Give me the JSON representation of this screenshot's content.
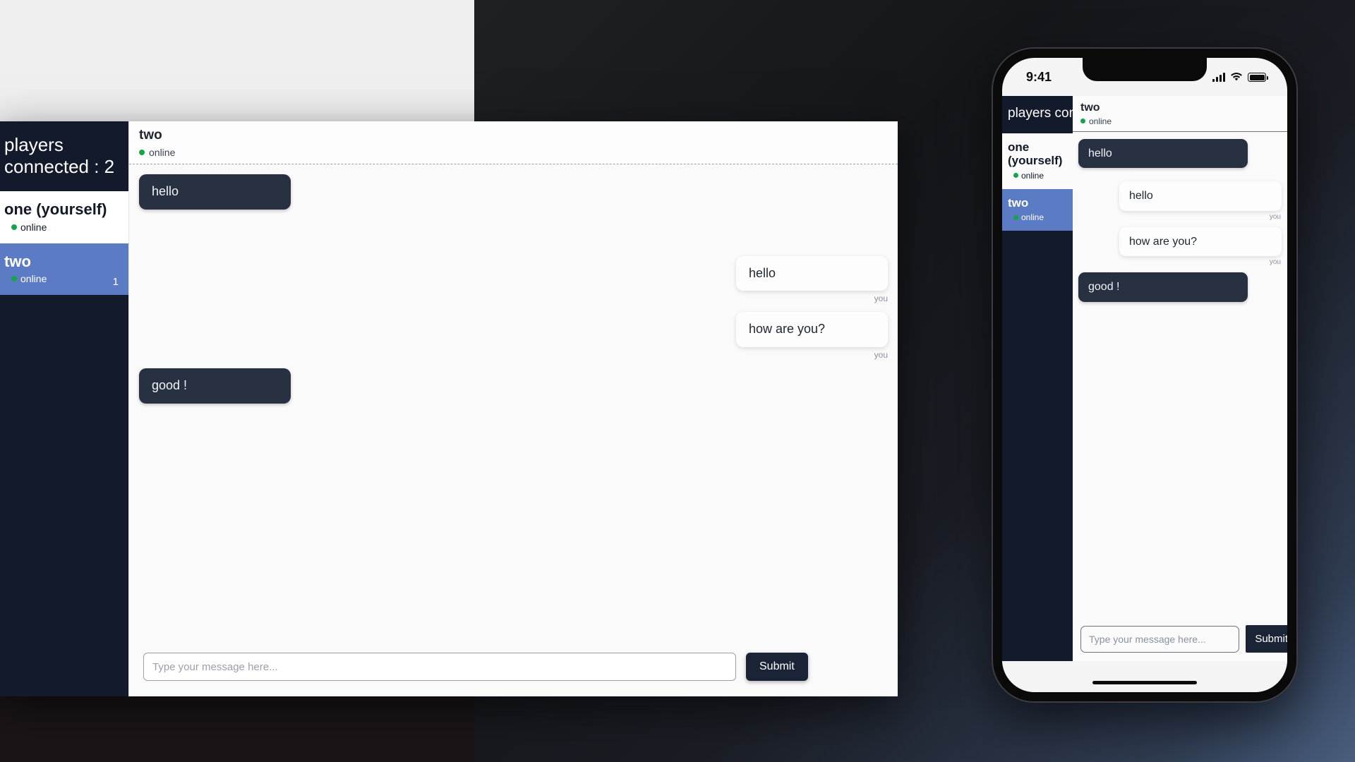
{
  "app": {
    "sidebar": {
      "players_connected_label": "players connected : 2",
      "players": [
        {
          "name": "one (yourself)",
          "status": "online",
          "selected": false,
          "badge": ""
        },
        {
          "name": "two",
          "status": "online",
          "selected": true,
          "badge": "1"
        }
      ]
    },
    "chat": {
      "header_name": "two",
      "header_status": "online",
      "messages": [
        {
          "text": "hello",
          "from": "them",
          "meta": ""
        },
        {
          "text": "hello",
          "from": "me",
          "meta": "you"
        },
        {
          "text": "how are you?",
          "from": "me",
          "meta": "you"
        },
        {
          "text": "good !",
          "from": "them",
          "meta": ""
        }
      ]
    },
    "composer": {
      "placeholder": "Type your message here...",
      "value": "",
      "submit_label": "Submit"
    }
  },
  "phone": {
    "status_bar": {
      "time": "9:41",
      "signal_icon": "cellular-bars-icon",
      "wifi_icon": "wifi-icon",
      "battery_icon": "battery-icon"
    }
  },
  "colors": {
    "sidebar_dark": "#131a2b",
    "selected_blue": "#5b7bc4",
    "bubble_them": "#273142",
    "bubble_me": "#fdfdfd",
    "online_green": "#16a34a",
    "submit_dark": "#1b2436"
  }
}
